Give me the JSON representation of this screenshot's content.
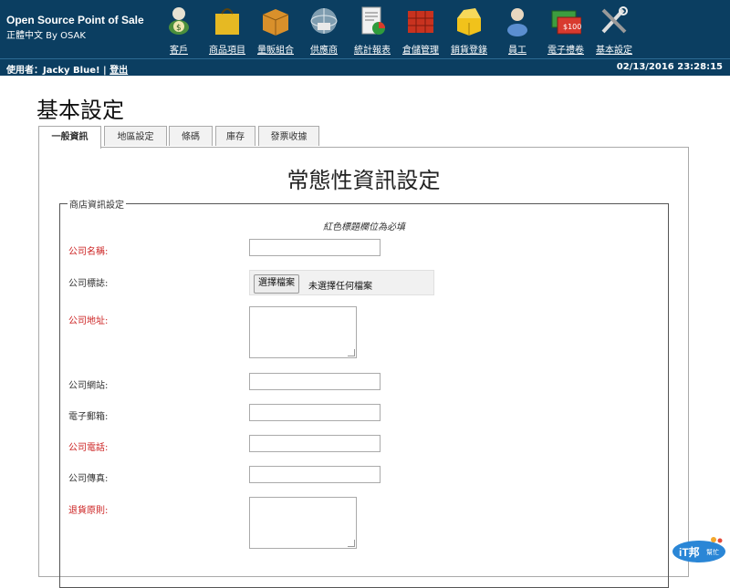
{
  "app": {
    "title": "Open Source Point of Sale",
    "subtitle": "正體中文 By OSAK"
  },
  "menu": [
    {
      "label": "客戶",
      "icon": "customer-icon"
    },
    {
      "label": "商品項目",
      "icon": "items-bag-icon"
    },
    {
      "label": "量販組合",
      "icon": "item-kits-box-icon"
    },
    {
      "label": "供應商",
      "icon": "suppliers-globe-icon"
    },
    {
      "label": "統計報表",
      "icon": "reports-chart-icon"
    },
    {
      "label": "倉儲管理",
      "icon": "receivings-warehouse-icon"
    },
    {
      "label": "銷貨登錄",
      "icon": "sales-box-icon"
    },
    {
      "label": "員工",
      "icon": "employees-person-icon"
    },
    {
      "label": "電子禮卷",
      "icon": "giftcards-icon"
    },
    {
      "label": "基本設定",
      "icon": "config-tools-icon"
    }
  ],
  "userbar": {
    "prefix": "使用者：Jacky Blue! |",
    "logout": "登出",
    "datetime": "02/13/2016 23:28:15"
  },
  "page": {
    "title": "基本設定"
  },
  "tabs": [
    {
      "label": "一般資訊",
      "active": true
    },
    {
      "label": "地區設定",
      "active": false
    },
    {
      "label": "條碼",
      "active": false
    },
    {
      "label": "庫存",
      "active": false
    },
    {
      "label": "發票收據",
      "active": false
    }
  ],
  "form": {
    "heading": "常態性資訊設定",
    "legend": "商店資訊設定",
    "required_note": "紅色標題欄位為必填",
    "fields": {
      "company_name": {
        "label": "公司名稱:",
        "value": ""
      },
      "company_logo": {
        "label": "公司標誌:",
        "button": "選擇檔案",
        "status": "未選擇任何檔案"
      },
      "company_address": {
        "label": "公司地址:",
        "value": ""
      },
      "website": {
        "label": "公司網站:",
        "value": ""
      },
      "email": {
        "label": "電子郵箱:",
        "value": ""
      },
      "phone": {
        "label": "公司電話:",
        "value": ""
      },
      "fax": {
        "label": "公司傳真:",
        "value": ""
      },
      "return_policy": {
        "label": "退貨原則:",
        "value": ""
      }
    }
  },
  "watermark": {
    "text": "iT邦幫忙"
  },
  "colors": {
    "header_bg": "#0b3e61",
    "required_label": "#c22222"
  }
}
